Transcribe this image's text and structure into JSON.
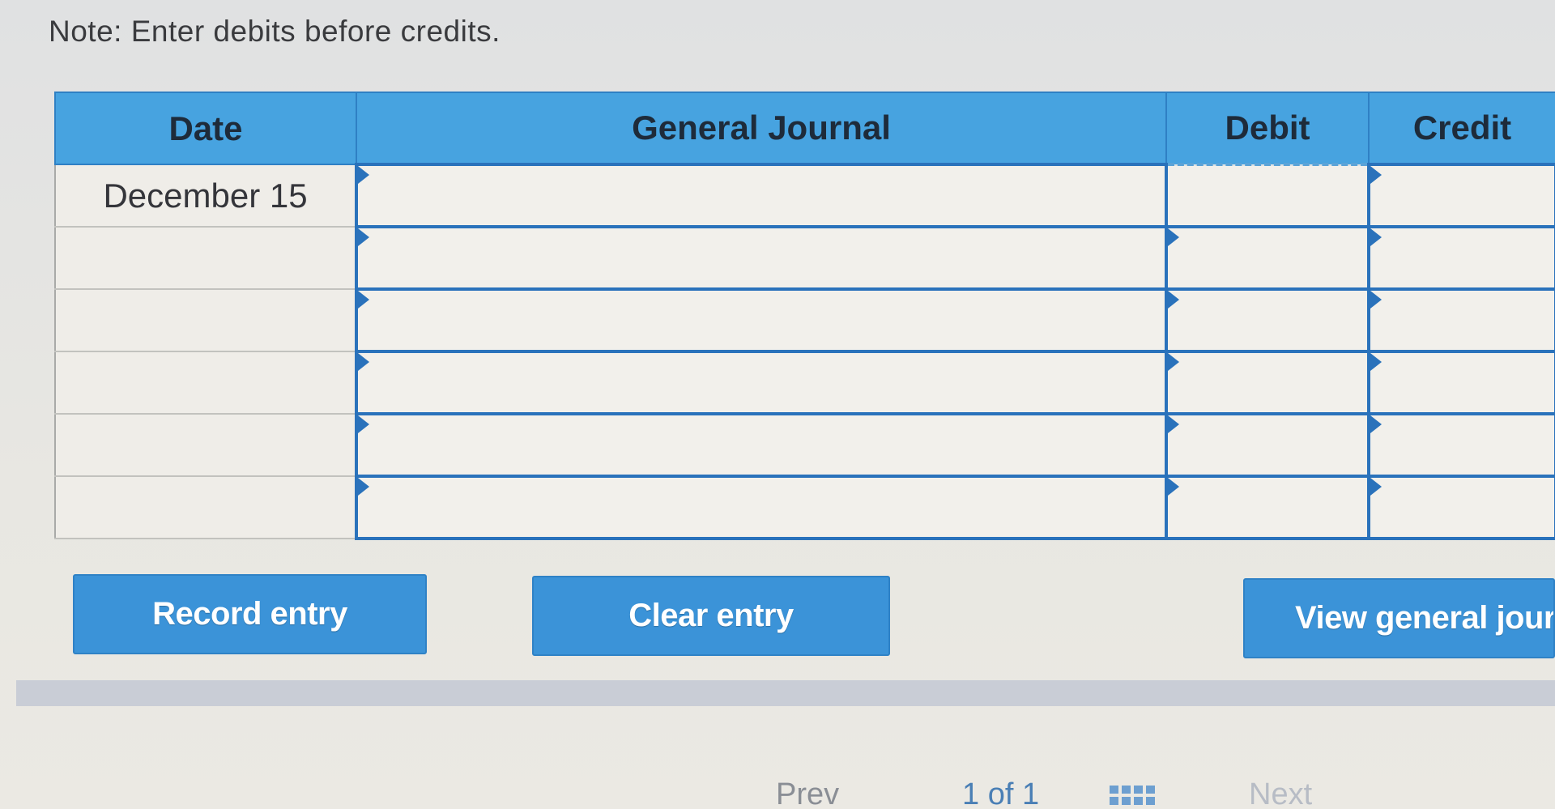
{
  "note": "Note: Enter debits before credits.",
  "table": {
    "headers": {
      "date": "Date",
      "journal": "General Journal",
      "debit": "Debit",
      "credit": "Credit"
    },
    "rows": [
      {
        "date": "December 15",
        "journal": "",
        "debit": "",
        "credit": ""
      },
      {
        "date": "",
        "journal": "",
        "debit": "",
        "credit": ""
      },
      {
        "date": "",
        "journal": "",
        "debit": "",
        "credit": ""
      },
      {
        "date": "",
        "journal": "",
        "debit": "",
        "credit": ""
      },
      {
        "date": "",
        "journal": "",
        "debit": "",
        "credit": ""
      },
      {
        "date": "",
        "journal": "",
        "debit": "",
        "credit": ""
      }
    ]
  },
  "buttons": {
    "record": "Record entry",
    "clear": "Clear entry",
    "view": "View general jour"
  },
  "pagination": {
    "prev": "Prev",
    "current": "1",
    "of": "of",
    "total": "1",
    "next": "Next",
    "grid_icon": "grid-icon"
  },
  "colors": {
    "header_bg": "#47a3e0",
    "button_bg": "#3b93d8",
    "input_border": "#2a72bb"
  }
}
